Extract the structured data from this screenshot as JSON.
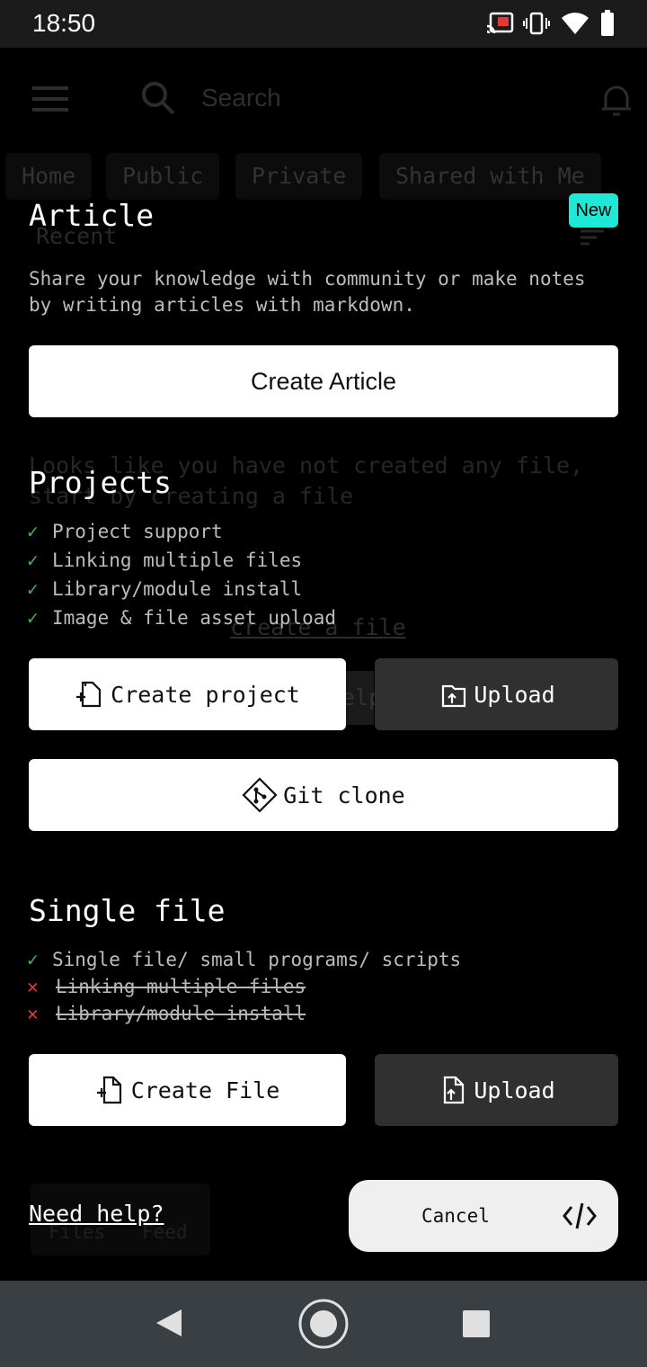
{
  "status_bar": {
    "time": "18:50"
  },
  "background": {
    "search_placeholder": "Search",
    "tabs": [
      "Home",
      "Public",
      "Private",
      "Shared with Me"
    ],
    "recent_label": "Recent",
    "empty_message_line1": "Looks like you have not created any file,",
    "empty_message_line2": "start by creating a file",
    "create_link": "create a file",
    "help_partial": "elp",
    "bottom_nav": [
      "Files",
      "Feed"
    ]
  },
  "article": {
    "title": "Article",
    "badge": "New",
    "description_line1": "Share your knowledge with community or make notes",
    "description_line2": "by writing articles with markdown.",
    "button": "Create Article"
  },
  "projects": {
    "title": "Projects",
    "features": [
      "Project support",
      "Linking multiple files",
      "Library/module install",
      "Image & file asset upload"
    ],
    "create_button": "Create project",
    "upload_button": "Upload",
    "git_button": "Git clone"
  },
  "single_file": {
    "title": "Single file",
    "feature_yes": "Single file/ small programs/ scripts",
    "features_no": [
      "Linking multiple files",
      "Library/module install"
    ],
    "create_button": "Create File",
    "upload_button": "Upload"
  },
  "footer": {
    "help_link": "Need help?",
    "cancel_button": "Cancel"
  },
  "colors": {
    "badge": "#1de9d6",
    "check": "#4caf50",
    "cross": "#e53935"
  }
}
